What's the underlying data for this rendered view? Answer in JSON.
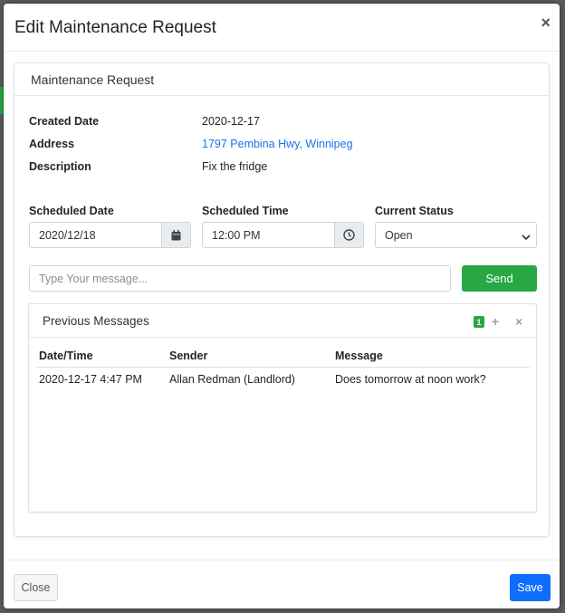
{
  "modal": {
    "title": "Edit Maintenance Request",
    "close_glyph": "×"
  },
  "card": {
    "title": "Maintenance Request",
    "info": [
      {
        "label": "Created Date",
        "value": "2020-12-17"
      },
      {
        "label": "Address",
        "value": "1797 Pembina Hwy, Winnipeg"
      },
      {
        "label": "Description",
        "value": "Fix the fridge"
      }
    ],
    "scheduled_date": {
      "label": "Scheduled Date",
      "value": "2020/12/18",
      "icon": "calendar-icon"
    },
    "scheduled_time": {
      "label": "Scheduled Time",
      "value": "12:00 PM",
      "icon": "clock-icon"
    },
    "status": {
      "label": "Current Status",
      "selected": "Open"
    },
    "message_input": {
      "placeholder": "Type Your message..."
    },
    "send_label": "Send"
  },
  "messages": {
    "title": "Previous Messages",
    "count": "1",
    "columns": [
      "Date/Time",
      "Sender",
      "Message"
    ],
    "rows": [
      [
        "2020-12-17 4:47 PM",
        "Allan Redman (Landlord)",
        "Does tomorrow at noon work?"
      ]
    ]
  },
  "footer": {
    "close_label": "Close",
    "save_label": "Save"
  },
  "colors": {
    "primary": "#0d6efd",
    "success": "#28a745",
    "link": "#1a73e8"
  }
}
